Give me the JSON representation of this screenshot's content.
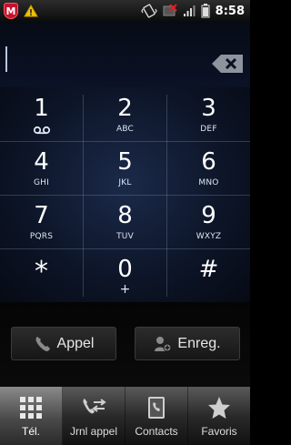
{
  "status_bar": {
    "time": "8:58"
  },
  "entry": {
    "value": ""
  },
  "keypad": {
    "keys": [
      {
        "digit": "1",
        "letters": ""
      },
      {
        "digit": "2",
        "letters": "ABC"
      },
      {
        "digit": "3",
        "letters": "DEF"
      },
      {
        "digit": "4",
        "letters": "GHI"
      },
      {
        "digit": "5",
        "letters": "JKL"
      },
      {
        "digit": "6",
        "letters": "MNO"
      },
      {
        "digit": "7",
        "letters": "PQRS"
      },
      {
        "digit": "8",
        "letters": "TUV"
      },
      {
        "digit": "9",
        "letters": "WXYZ"
      },
      {
        "digit": "*",
        "letters": ""
      },
      {
        "digit": "0",
        "letters": "+"
      },
      {
        "digit": "#",
        "letters": ""
      }
    ]
  },
  "actions": {
    "call_label": "Appel",
    "save_label": "Enreg."
  },
  "tabs": [
    {
      "label": "Tél.",
      "icon": "dialpad-icon",
      "active": true
    },
    {
      "label": "Jrnl appel",
      "icon": "call-log-icon",
      "active": false
    },
    {
      "label": "Contacts",
      "icon": "contacts-icon",
      "active": false
    },
    {
      "label": "Favoris",
      "icon": "star-icon",
      "active": false
    }
  ],
  "colors": {
    "keypad_bg": "#1b2a4a",
    "mcafee_red": "#c8102e",
    "warning_yellow": "#f2c200"
  }
}
